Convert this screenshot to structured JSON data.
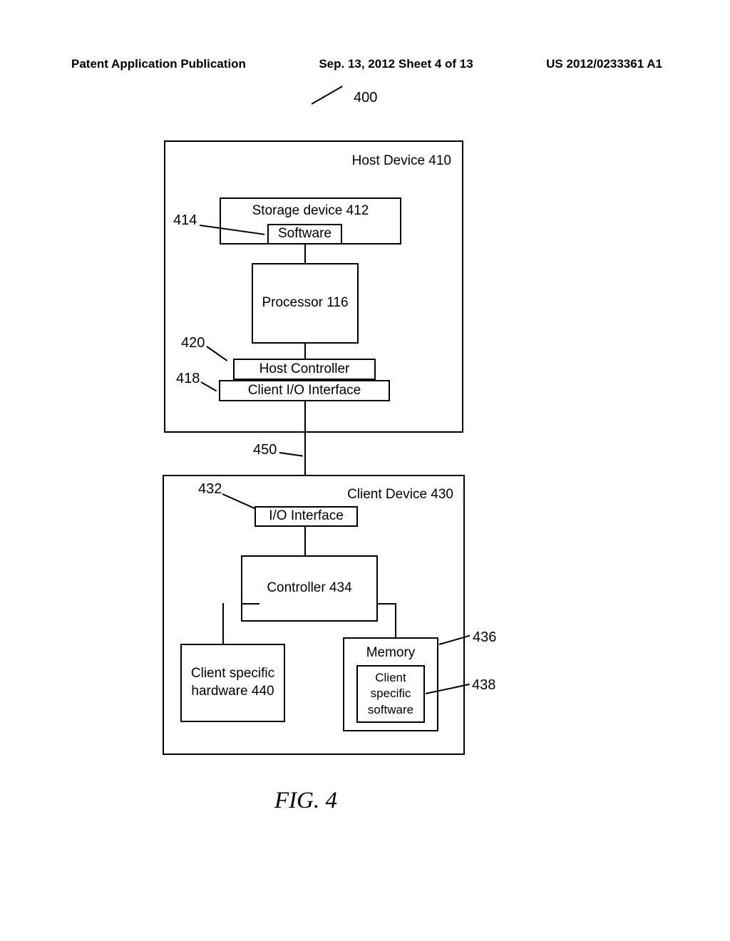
{
  "header": {
    "left": "Patent Application Publication",
    "center": "Sep. 13, 2012  Sheet 4 of 13",
    "right": "US 2012/0233361 A1"
  },
  "refs": {
    "system": "400",
    "host_device": "Host Device 410",
    "storage_device": "Storage device 412",
    "software": "Software",
    "software_ref": "414",
    "processor": "Processor 116",
    "host_controller": "Host Controller",
    "host_controller_ref": "420",
    "client_io_iface": "Client I/O Interface",
    "client_io_iface_ref": "418",
    "link_ref": "450",
    "client_device": "Client Device 430",
    "io_iface": "I/O Interface",
    "io_iface_ref": "432",
    "controller": "Controller 434",
    "client_hw": "Client specific hardware 440",
    "memory": "Memory",
    "memory_ref": "436",
    "client_sw": "Client specific software",
    "client_sw_ref": "438"
  },
  "figure": "FIG. 4"
}
